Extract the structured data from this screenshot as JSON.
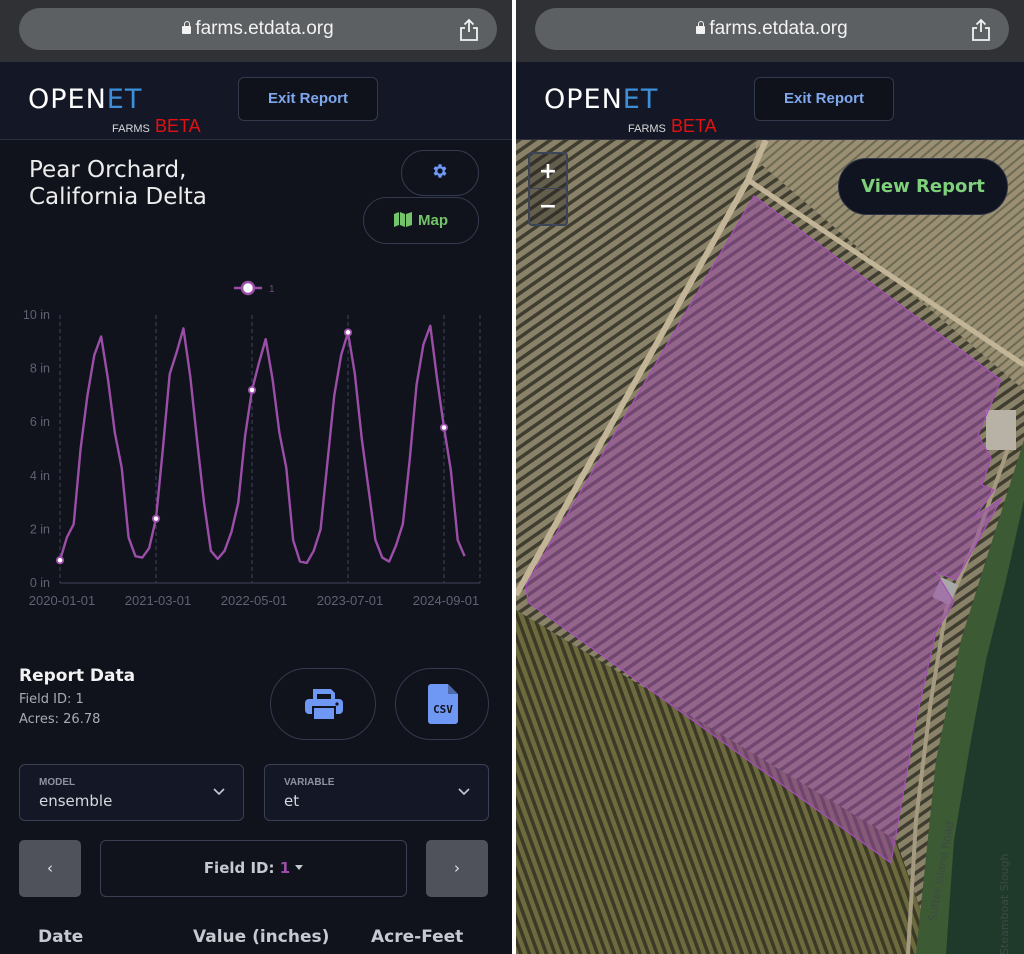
{
  "browser": {
    "url": "farms.etdata.org",
    "lock_icon": "lock-icon",
    "share_icon": "share-icon"
  },
  "header": {
    "logo_main": "OPEN",
    "logo_et": "ET",
    "logo_farms": "FARMS",
    "logo_beta": "BETA",
    "exit_label": "Exit Report"
  },
  "report": {
    "title_line1": "Pear Orchard,",
    "title_line2": "California Delta",
    "settings_icon": "gear-icon",
    "map_label": "Map",
    "section_title": "Report Data",
    "field_id": "Field ID: 1",
    "acres": "Acres: 26.78",
    "print_icon": "print-icon",
    "csv_icon": "csv-file-icon",
    "csv_text": "CSV",
    "model": {
      "label": "MODEL",
      "value": "ensemble"
    },
    "variable": {
      "label": "VARIABLE",
      "value": "et"
    },
    "prev_label": "‹",
    "next_label": "›",
    "field_selector_label": "Field ID: ",
    "field_selector_value": "1",
    "columns": [
      "Date",
      "Value (inches)",
      "Acre-Feet"
    ]
  },
  "map": {
    "zoom_in": "+",
    "zoom_out": "−",
    "view_report_label": "View Report",
    "labels": [
      "Sutter Island Road",
      "Steamboat Slough"
    ]
  },
  "colors": {
    "series": "#9b4ea7",
    "accent_blue": "#6f97f4",
    "accent_green": "#73c46a",
    "beta_red": "#e41010",
    "field_overlay": "#9b4ea7"
  },
  "chart_data": {
    "type": "line",
    "title": "",
    "xlabel": "",
    "ylabel": "",
    "legend": [
      "1"
    ],
    "legend_position": "top-center",
    "ylim": [
      0,
      10
    ],
    "y_ticks": [
      "0 in",
      "2 in",
      "4 in",
      "6 in",
      "8 in",
      "10 in"
    ],
    "y_tick_values": [
      0,
      2,
      4,
      6,
      8,
      10
    ],
    "x_ticks": [
      "2020-01-01",
      "2021-03-01",
      "2022-05-01",
      "2023-07-01",
      "2024-09-01"
    ],
    "x_tick_month_index": [
      0,
      14,
      28,
      42,
      56
    ],
    "x_range_month_index": [
      0,
      61
    ],
    "grid": "vertical dashed at x ticks",
    "marker_indices": [
      0,
      14,
      28,
      42,
      56
    ],
    "series": [
      {
        "name": "1",
        "start": "2020-01",
        "frequency": "monthly",
        "values": [
          0.85,
          1.7,
          2.2,
          5.0,
          7.0,
          8.5,
          9.2,
          7.6,
          5.6,
          4.3,
          1.7,
          1.0,
          0.95,
          1.3,
          2.4,
          5.0,
          7.8,
          8.6,
          9.5,
          7.7,
          5.3,
          3.0,
          1.2,
          0.9,
          1.2,
          1.9,
          3.0,
          5.5,
          7.2,
          8.2,
          9.1,
          7.6,
          5.6,
          4.3,
          1.6,
          0.8,
          0.75,
          1.2,
          2.0,
          4.5,
          7.0,
          8.5,
          9.35,
          7.8,
          5.4,
          3.5,
          1.6,
          0.95,
          0.8,
          1.4,
          2.2,
          4.6,
          7.4,
          8.9,
          9.6,
          7.6,
          5.8,
          4.2,
          1.6,
          1.0
        ]
      }
    ]
  }
}
